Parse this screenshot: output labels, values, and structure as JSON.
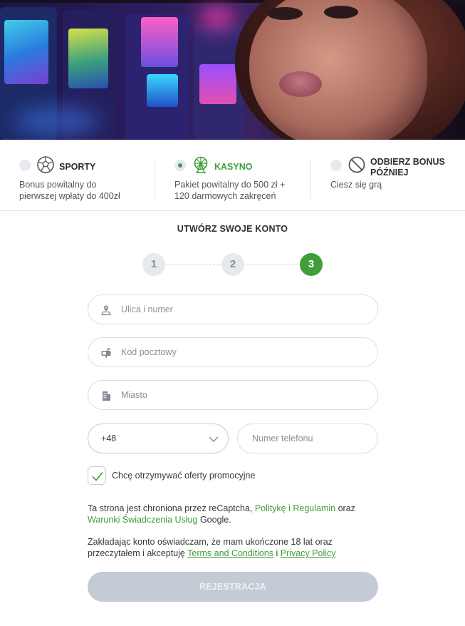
{
  "bonus_options": [
    {
      "title": "SPORTY",
      "description_line1": "Bonus powitalny do",
      "description_line2": "pierwszej wpłaty do 400zł",
      "selected": false,
      "icon": "soccer-ball-icon"
    },
    {
      "title": "KASYNO",
      "description_line1": "Pakiet powitalny do 500 zł +",
      "description_line2": "120 darmowych zakręceń",
      "selected": true,
      "icon": "ferris-wheel-icon"
    },
    {
      "title_line1": "ODBIERZ BONUS",
      "title_line2": "PÓŹNIEJ",
      "description_line1": "Ciesz się grą",
      "selected": false,
      "icon": "no-sign-icon"
    }
  ],
  "form": {
    "title": "UTWÓRZ SWOJE KONTO",
    "steps": [
      "1",
      "2",
      "3"
    ],
    "active_step": 3,
    "fields": {
      "street": {
        "placeholder": "Ulica i numer",
        "icon": "map-pin-icon"
      },
      "postal": {
        "placeholder": "Kod pocztowy",
        "icon": "mailbox-icon"
      },
      "city": {
        "placeholder": "Miasto",
        "icon": "building-icon"
      }
    },
    "phone_prefix": "+48",
    "phone_placeholder": "Numer telefonu",
    "promo_checkbox_label": "Chcę otrzymywać oferty promocyjne",
    "promo_checked": true,
    "recaptcha_text_1": "Ta strona jest chroniona przez reCaptcha, ",
    "recaptcha_link_1": "Politykę i Regulamin",
    "recaptcha_text_2": " oraz",
    "recaptcha_link_2": "Warunki Świadczenia Usług",
    "recaptcha_text_3": " Google.",
    "consent_text_1": "Zakładając konto oświadczam, że mam ukończone 18 lat oraz",
    "consent_text_2": "przeczytałem i akceptuję ",
    "terms_link": "Terms and Conditions",
    "consent_and": " i ",
    "privacy_link": "Privacy Policy",
    "submit_label": "REJESTRACJA"
  },
  "colors": {
    "accent_green": "#3f9e3a",
    "disabled_button": "#c5cbd5",
    "input_border": "#dcdfe4"
  }
}
